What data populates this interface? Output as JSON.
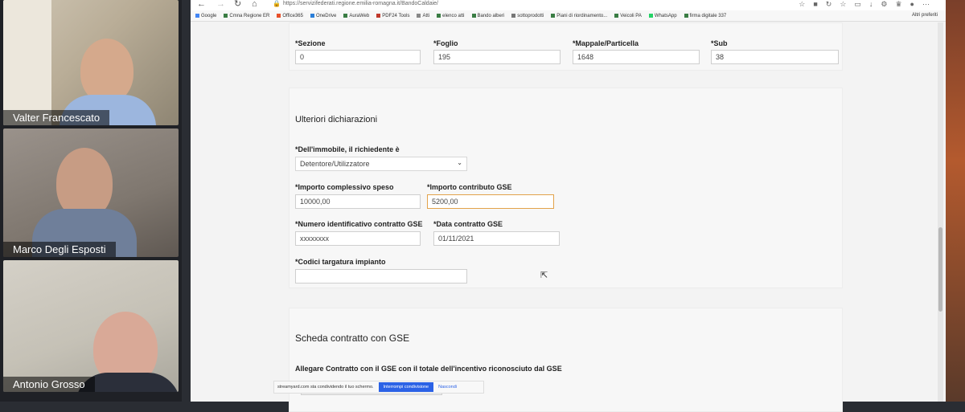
{
  "participants": [
    {
      "name": "Valter Francescato"
    },
    {
      "name": "Marco Degli Esposti"
    },
    {
      "name": "Antonio Grosso"
    }
  ],
  "browser": {
    "url": "https://servizifederati.regione.emilia-romagna.it/BandoCaldaie/",
    "bookmarks": [
      "Google",
      "Cmna Regione ER",
      "Office365",
      "OneDrive",
      "AuraWeb",
      "PDF24 Tools",
      "Atti",
      "elenco atti",
      "Bando alberi",
      "sottoprodotti",
      "Piani di riordinamento...",
      "Veicoli PA",
      "WhatsApp",
      "firma digitale 337"
    ],
    "bookmarks_right": "Altri preferiti"
  },
  "top_section": {
    "fields": [
      {
        "label": "*Sezione",
        "value": "0"
      },
      {
        "label": "*Foglio",
        "value": "195"
      },
      {
        "label": "*Mappale/Particella",
        "value": "1648"
      },
      {
        "label": "*Sub",
        "value": "38"
      }
    ]
  },
  "ulteriori": {
    "title": "Ulteriori dichiarazioni",
    "immobile_label": "*Dell'immobile, il richiedente è",
    "immobile_value": "Detentore/Utilizzatore",
    "importo_label": "*Importo complessivo speso",
    "importo_value": "10000,00",
    "contributo_label": "*Importo contributo GSE",
    "contributo_value": "5200,00",
    "numero_label": "*Numero identificativo contratto GSE",
    "numero_value": "xxxxxxxx",
    "data_label": "*Data contratto GSE",
    "data_value": "01/11/2021",
    "codici_label": "*Codici targatura impianto",
    "codici_value": ""
  },
  "scheda": {
    "title": "Scheda contratto con GSE",
    "allegare_label": "Allegare Contratto con il GSE con il totale dell'incentivo riconosciuto dal GSE"
  },
  "sharebar": {
    "message": "streamyard.com sta condividendo il tuo schermo.",
    "stop_button": "Interrompi condivisione",
    "hide_link": "Nascondi"
  }
}
